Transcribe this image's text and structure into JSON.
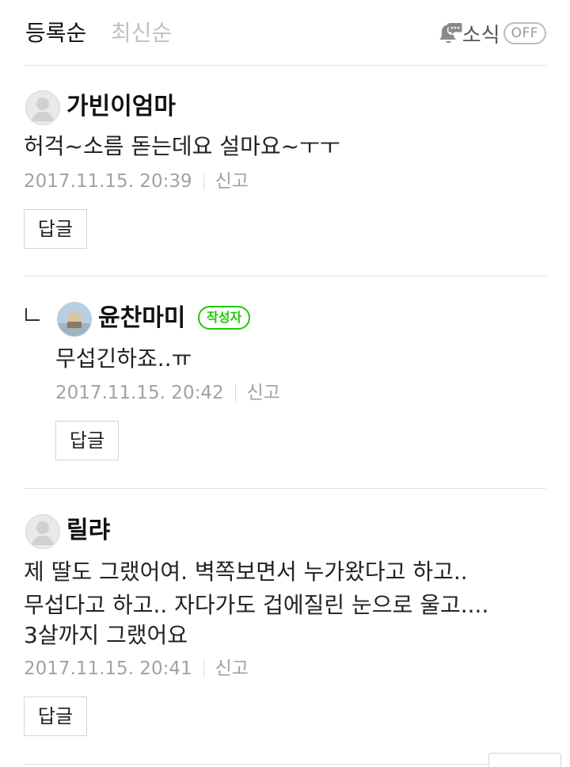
{
  "sort": {
    "registered_label": "등록순",
    "latest_label": "최신순"
  },
  "notify": {
    "label": "소식",
    "toggle_label": "OFF"
  },
  "comments": [
    {
      "nickname": "가빈이엄마",
      "lines": [
        "허걱~소름 돋는데요 설마요~ㅜㅜ"
      ],
      "date": "2017.11.15. 20:39",
      "report_label": "신고",
      "reply_label": "답글"
    },
    {
      "nickname": "윤찬마미",
      "badge": "작성자",
      "lines": [
        "무섭긴하죠..ㅠ"
      ],
      "date": "2017.11.15. 20:42",
      "report_label": "신고",
      "reply_label": "답글"
    },
    {
      "nickname": "릴랴",
      "lines": [
        "제 딸도 그랬어여. 벽쪽보면서 누가왔다고 하고..",
        "무섭다고 하고.. 자다가도 겁에질린 눈으로 울고....",
        "3살까지 그랬어요"
      ],
      "date": "2017.11.15. 20:41",
      "report_label": "신고",
      "reply_label": "답글"
    }
  ],
  "colors": {
    "accent_green": "#1ec800",
    "muted_text": "#a2a2a2",
    "divider": "#e4e4e4"
  }
}
